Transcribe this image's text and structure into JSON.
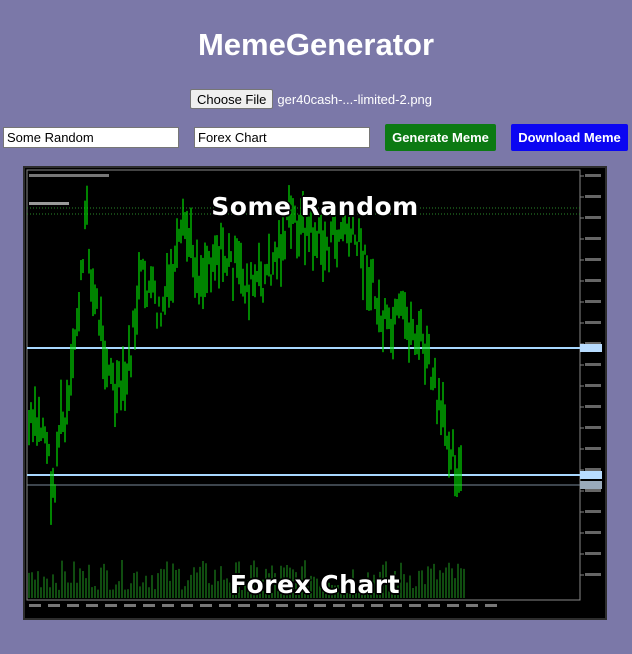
{
  "app": {
    "title": "MemeGenerator"
  },
  "file": {
    "button_label": "Choose File",
    "selected_name": "ger40cash-...-limited-2.png"
  },
  "inputs": {
    "top_text": "Some Random",
    "bottom_text": "Forex Chart"
  },
  "buttons": {
    "generate_label": "Generate Meme",
    "download_label": "Download Meme"
  },
  "meme": {
    "top_caption": "Some Random",
    "bottom_caption": "Forex Chart"
  },
  "colors": {
    "page_bg": "#7b78a8",
    "generate_btn": "#0c7a13",
    "download_btn": "#0b06f2",
    "candles": "#00dd00",
    "hlines": "#a8d8ff",
    "chart_bg": "#000000"
  }
}
